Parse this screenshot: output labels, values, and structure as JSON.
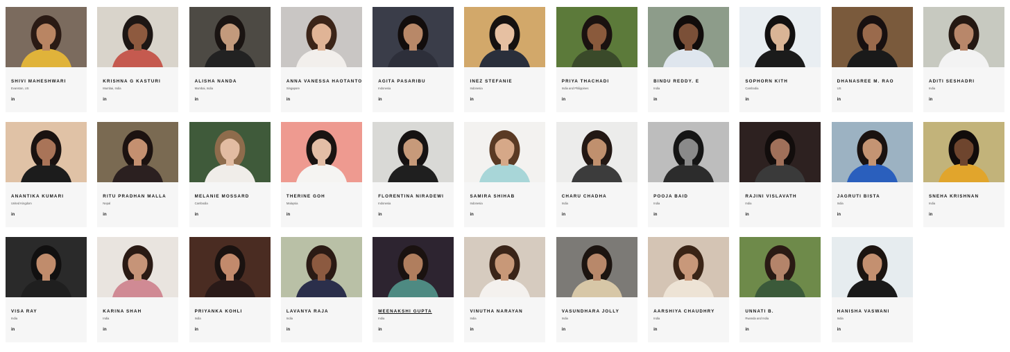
{
  "profiles": [
    {
      "name": "Shivi Maheshwari",
      "location": "Evanston, US",
      "bg": "#7b6b5e",
      "skin": "#b98563",
      "hair": "#2a1a14",
      "top": "#e0b33a"
    },
    {
      "name": "Krishna G Kasturi",
      "location": "Mumbai, India",
      "bg": "#d9d4cb",
      "skin": "#8e5a3f",
      "hair": "#1d1614",
      "top": "#c55a4f"
    },
    {
      "name": "Alisha Nanda",
      "location": "Mumbai, India",
      "bg": "#4d4a44",
      "skin": "#c39a7c",
      "hair": "#1a1412",
      "top": "#222222"
    },
    {
      "name": "Anna Vanessa Haotanto",
      "location": "Singapore",
      "bg": "#c9c6c4",
      "skin": "#e0b496",
      "hair": "#3b2418",
      "top": "#f2efec"
    },
    {
      "name": "Agita Pasaribu",
      "location": "Indonesia",
      "bg": "#3a3d49",
      "skin": "#b88868",
      "hair": "#120d0c",
      "top": "#2d2f3a"
    },
    {
      "name": "Inez Stefanie",
      "location": "Indonesia",
      "bg": "#d2a86a",
      "skin": "#e6c0a2",
      "hair": "#151110",
      "top": "#2a2f3b"
    },
    {
      "name": "Priya Thachadi",
      "location": "India and Philippines",
      "bg": "#5c7a3a",
      "skin": "#8a5a3c",
      "hair": "#1a1210",
      "top": "#3a4a2a"
    },
    {
      "name": "Bindu Reddy. E",
      "location": "India",
      "bg": "#8d9c8a",
      "skin": "#7b5038",
      "hair": "#110c0b",
      "top": "#dfe6ee"
    },
    {
      "name": "Sophorn Kith",
      "location": "Cambodia",
      "bg": "#e9eef2",
      "skin": "#d9b496",
      "hair": "#121010",
      "top": "#1b1b1b"
    },
    {
      "name": "Dhanasree M. Rao",
      "location": "US",
      "bg": "#7a5a3c",
      "skin": "#9a6a4c",
      "hair": "#181010",
      "top": "#1a1a1a"
    },
    {
      "name": "Aditi Seshadri",
      "location": "India",
      "bg": "#c7c9c0",
      "skin": "#b8876a",
      "hair": "#241812",
      "top": "#f3f3f3"
    },
    {
      "name": "Anantika Kumari",
      "location": "United Kingdom",
      "bg": "#e0c2a6",
      "skin": "#a97458",
      "hair": "#1a1210",
      "top": "#1c1c1c"
    },
    {
      "name": "Ritu Pradhan Malla",
      "location": "Nepal",
      "bg": "#7a6a52",
      "skin": "#c49070",
      "hair": "#1c1210",
      "top": "#2b2020"
    },
    {
      "name": "Melanie Mossard",
      "location": "Cambodia",
      "bg": "#3f5a3a",
      "skin": "#e2bca2",
      "hair": "#8e6c4c",
      "top": "#f0ede9"
    },
    {
      "name": "Therine Goh",
      "location": "Malaysia",
      "bg": "#ee9a90",
      "skin": "#e3bea6",
      "hair": "#1a1412",
      "top": "#f5f4f2"
    },
    {
      "name": "Florentina Niradewi",
      "location": "Indonesia",
      "bg": "#d9d9d6",
      "skin": "#c79a7a",
      "hair": "#161212",
      "top": "#1f1f1f"
    },
    {
      "name": "Samira Shihab",
      "location": "Indonesia",
      "bg": "#f3f2f0",
      "skin": "#d6a888",
      "hair": "#5a3a24",
      "top": "#a8d6d8"
    },
    {
      "name": "Charu Chadha",
      "location": "India",
      "bg": "#ececeb",
      "skin": "#c0906e",
      "hair": "#231814",
      "top": "#3c3c3c"
    },
    {
      "name": "Pooja Baid",
      "location": "India",
      "bg": "#bdbdbd",
      "skin": "#8a8a8a",
      "hair": "#151515",
      "top": "#2c2c2c"
    },
    {
      "name": "Rajini Vislavath",
      "location": "India",
      "bg": "#2d2120",
      "skin": "#a0705a",
      "hair": "#120d0c",
      "top": "#3a3a3a"
    },
    {
      "name": "Jagruti Bista",
      "location": "India",
      "bg": "#9cb2c2",
      "skin": "#c49473",
      "hair": "#1a1210",
      "top": "#2a5fbd"
    },
    {
      "name": "Sneha Krishnan",
      "location": "India",
      "bg": "#c2b37a",
      "skin": "#6e452e",
      "hair": "#110c0b",
      "top": "#e1a52c"
    },
    {
      "name": "Visa Ray",
      "location": "India",
      "bg": "#2a2a2a",
      "skin": "#c08c6c",
      "hair": "#111010",
      "top": "#1f1f1f"
    },
    {
      "name": "Karina Shah",
      "location": "India",
      "bg": "#e9e4df",
      "skin": "#c69478",
      "hair": "#2a1a14",
      "top": "#d08a94"
    },
    {
      "name": "Priyanka Kohli",
      "location": "India",
      "bg": "#4a2c22",
      "skin": "#c28a6c",
      "hair": "#1a1210",
      "top": "#2a1a18"
    },
    {
      "name": "Lavanya Raja",
      "location": "India",
      "bg": "#b9c0a6",
      "skin": "#8c5a40",
      "hair": "#2a1a14",
      "top": "#2b2f4b"
    },
    {
      "name": "Meenakshi Gupta",
      "location": "India",
      "bg": "#2d2430",
      "skin": "#b07e5e",
      "hair": "#1a1210",
      "top": "#4e8a82"
    },
    {
      "name": "Vinutha Narayan",
      "location": "India",
      "bg": "#d6cbbf",
      "skin": "#c89878",
      "hair": "#3a2418",
      "top": "#f4f1ee"
    },
    {
      "name": "Vasundhara Jolly",
      "location": "India",
      "bg": "#7c7a76",
      "skin": "#b8886a",
      "hair": "#1c1410",
      "top": "#d7c7a7"
    },
    {
      "name": "Aarshiya Chaudhry",
      "location": "India",
      "bg": "#d4c4b4",
      "skin": "#c8987a",
      "hair": "#3a2416",
      "top": "#ede3d5"
    },
    {
      "name": "Unnati B.",
      "location": "Rwanda and India",
      "bg": "#6e8a4a",
      "skin": "#b4846a",
      "hair": "#2a1a14",
      "top": "#3b5a3a"
    },
    {
      "name": "Hanisha Vaswani",
      "location": "India",
      "bg": "#e6ecef",
      "skin": "#c49070",
      "hair": "#1c1410",
      "top": "#1a1a1a"
    }
  ],
  "linkedin_label": "in",
  "highlighted_name": "Meenakshi Gupta"
}
